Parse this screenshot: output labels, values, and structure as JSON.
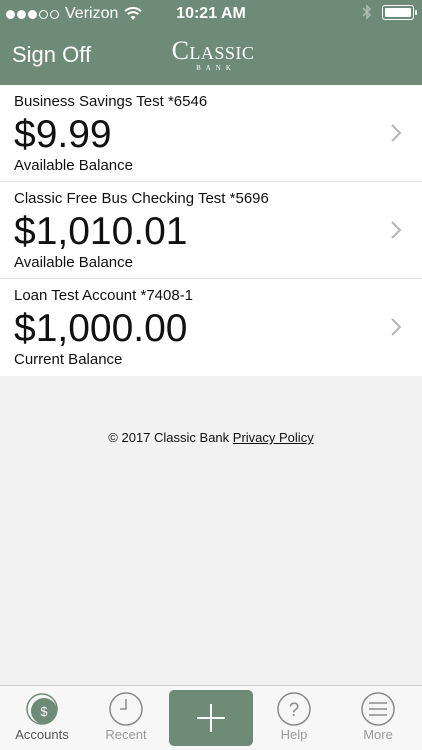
{
  "status_bar": {
    "carrier": "Verizon",
    "time": "10:21 AM",
    "battery_level": 1.0
  },
  "header": {
    "sign_off_label": "Sign Off",
    "logo_text": "Classic",
    "logo_subtext": "BANK"
  },
  "accounts": [
    {
      "name": "Business Savings Test *6546",
      "amount": "$9.99",
      "balance_label": "Available Balance"
    },
    {
      "name": "Classic Free Bus Checking Test *5696",
      "amount": "$1,010.01",
      "balance_label": "Available Balance"
    },
    {
      "name": "Loan Test Account *7408-1",
      "amount": "$1,000.00",
      "balance_label": "Current Balance"
    }
  ],
  "footer": {
    "copyright": "© 2017 Classic Bank",
    "privacy_link": "Privacy Policy"
  },
  "tab_bar": {
    "tabs": [
      {
        "label": "Accounts",
        "icon": "dollar-icon",
        "active": true
      },
      {
        "label": "Recent",
        "icon": "clock-icon",
        "active": false
      },
      {
        "label": "Help",
        "icon": "help-icon",
        "active": false
      },
      {
        "label": "More",
        "icon": "menu-icon",
        "active": false
      }
    ],
    "add_icon": "plus-icon"
  },
  "colors": {
    "brand": "#6e8b78",
    "background": "#f2f2f2",
    "tab_inactive": "#9a9a9a"
  }
}
